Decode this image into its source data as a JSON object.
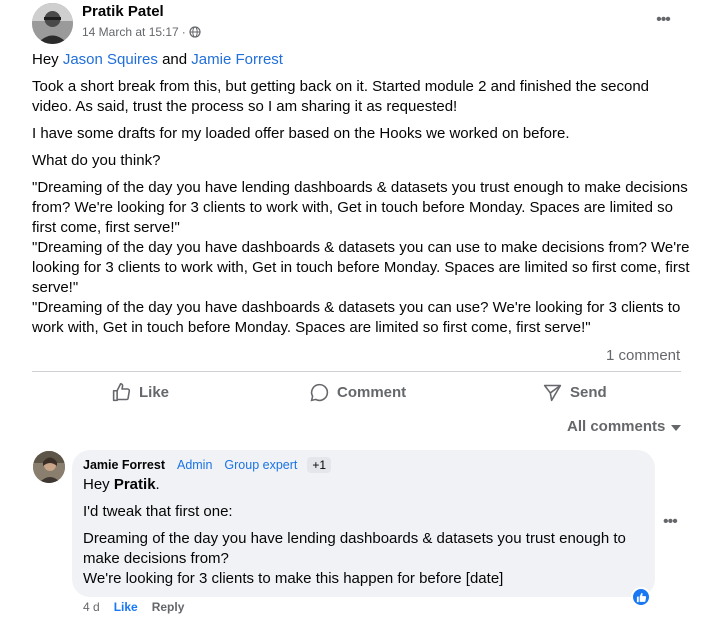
{
  "post": {
    "author": "Pratik Patel",
    "timestamp": "14 March at 15:17",
    "separator": "·",
    "audience_icon": "globe-icon",
    "greeting": {
      "prefix": "Hey ",
      "mention_1": "Jason Squires",
      "connector": " and ",
      "mention_2": "Jamie Forrest"
    },
    "paragraphs": [
      "Took a short break from this, but getting back on it. Started module 2 and finished the second video. As said, trust the process so I am sharing it as requested!",
      "I have some drafts for my loaded offer based on the Hooks we worked on before.",
      "What do you think?"
    ],
    "quotes": [
      "\"Dreaming of the day you have lending dashboards & datasets you trust enough to make decisions from? We're looking for 3 clients to work with, Get in touch before Monday. Spaces are limited so first come, first serve!\"",
      "\"Dreaming of the day you have dashboards & datasets you can use to make decisions from? We're looking for 3 clients to work with, Get in touch before Monday. Spaces are limited so first come, first serve!\"",
      "\"Dreaming of the day you have dashboards & datasets you can use? We're looking for 3 clients to work with, Get in touch before Monday. Spaces are limited so first come, first serve!\""
    ],
    "comment_count": "1 comment"
  },
  "actions": {
    "like": "Like",
    "comment": "Comment",
    "send": "Send"
  },
  "comments_filter": "All comments",
  "comment": {
    "author": "Jamie Forrest",
    "badge_admin": "Admin",
    "badge_group_expert": "Group expert",
    "badge_plus": "+1",
    "greeting_prefix": "Hey ",
    "greeting_mention": "Pratik",
    "greeting_suffix": ".",
    "lines": [
      "I'd tweak that first one:",
      "Dreaming of the day you have lending dashboards & datasets you trust enough to make decisions from?",
      "We're looking for 3 clients to make this happen for before [date]"
    ],
    "time": "4 d",
    "like": "Like",
    "reply": "Reply",
    "reaction_icon": "thumbs-up-icon"
  },
  "colors": {
    "link": "#216fdb",
    "muted": "#65676b",
    "bubble": "#f0f2f5",
    "like_blue": "#1877f2"
  }
}
